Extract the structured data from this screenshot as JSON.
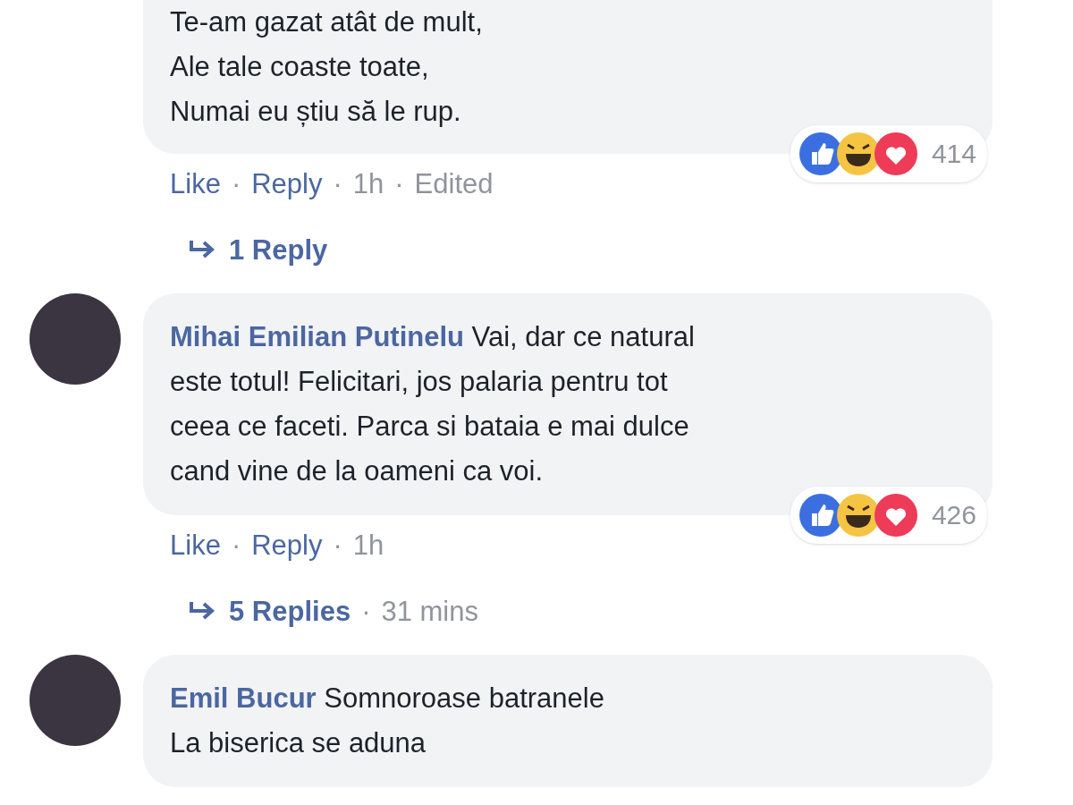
{
  "separator": "·",
  "comments": [
    {
      "lines": [
        "Te-am gazat atât de mult,",
        "Ale tale coaste toate,",
        "Numai eu știu să le rup."
      ],
      "reactions": {
        "count": "414"
      },
      "actions": [
        {
          "label": "Like",
          "kind": "link"
        },
        {
          "label": "Reply",
          "kind": "link"
        },
        {
          "label": "1h",
          "kind": "meta"
        },
        {
          "label": "Edited",
          "kind": "meta"
        }
      ],
      "replies": {
        "label": "1 Reply"
      }
    },
    {
      "author": "Mihai Emilian Putinelu",
      "lines": [
        "Vai, dar ce natural",
        "este totul! Felicitari, jos palaria pentru tot",
        "ceea ce faceti. Parca si bataia e mai dulce",
        "cand vine de la oameni ca voi."
      ],
      "reactions": {
        "count": "426"
      },
      "actions": [
        {
          "label": "Like",
          "kind": "link"
        },
        {
          "label": "Reply",
          "kind": "link"
        },
        {
          "label": "1h",
          "kind": "meta"
        }
      ],
      "replies": {
        "label": "5 Replies",
        "time": "31 mins"
      }
    },
    {
      "author": "Emil Bucur",
      "lines": [
        "Somnoroase batranele",
        "La biserica se aduna"
      ]
    }
  ]
}
